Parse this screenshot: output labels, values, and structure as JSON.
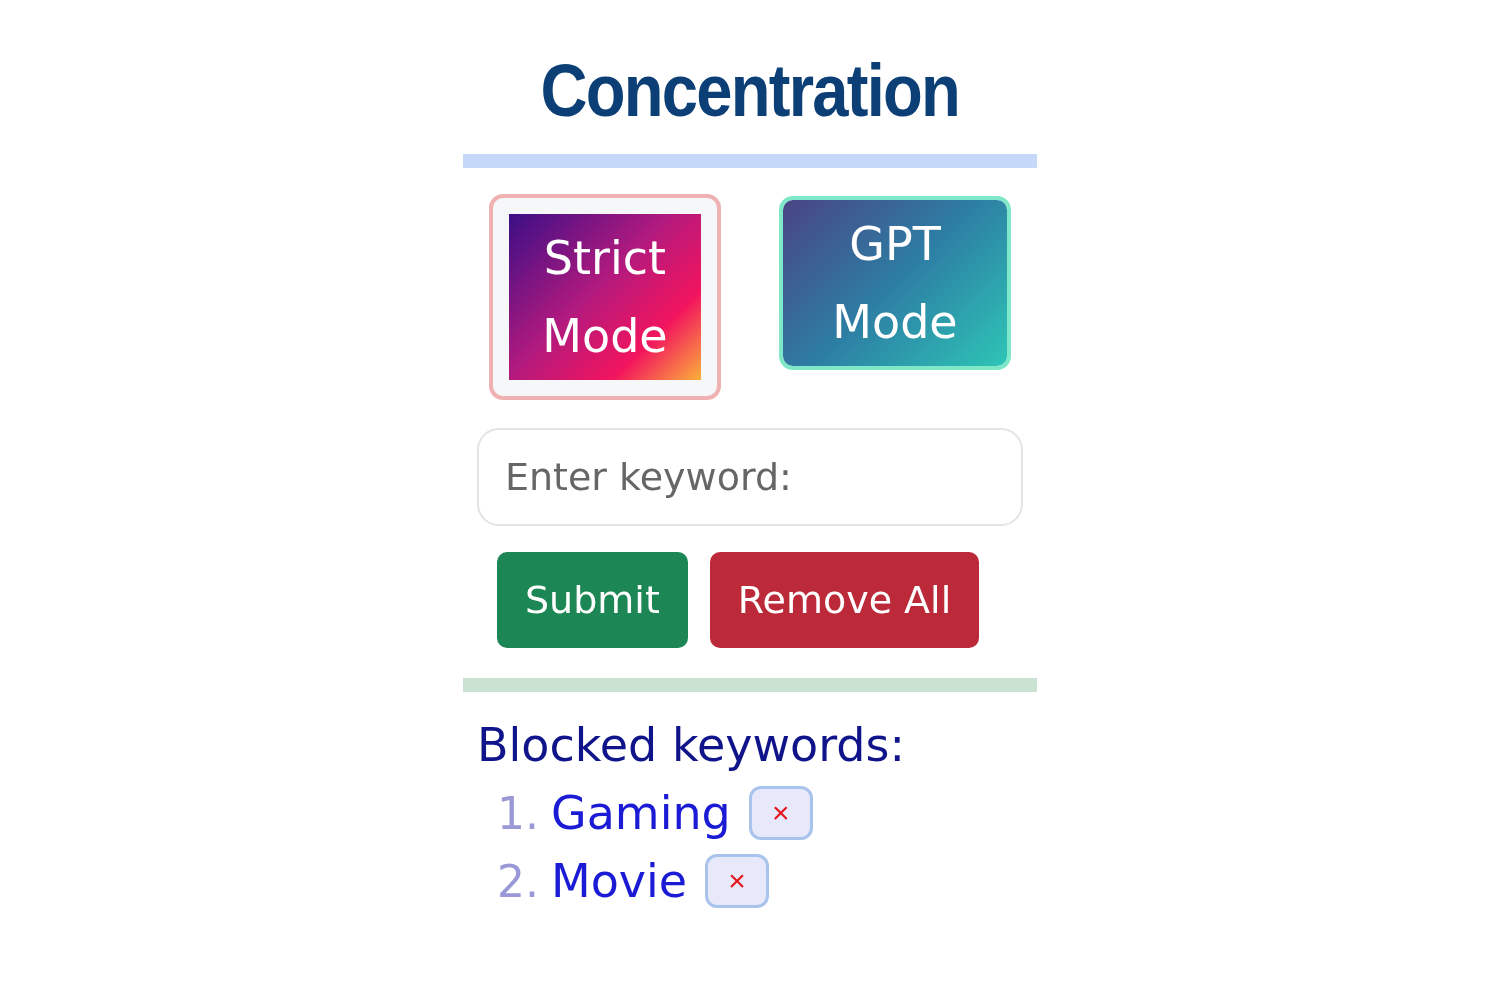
{
  "title": "Concentration",
  "modes": [
    {
      "label_lines": [
        "Strict",
        "Mode"
      ],
      "kind": "strict",
      "selected": true
    },
    {
      "label_lines": [
        "GPT",
        "Mode"
      ],
      "kind": "gpt",
      "selected": false
    }
  ],
  "keyword_field": {
    "placeholder": "Enter keyword:"
  },
  "buttons": [
    {
      "label": "Submit",
      "kind": "submit"
    },
    {
      "label": "Remove All",
      "kind": "remove"
    }
  ],
  "blocked": {
    "heading": "Blocked keywords:",
    "items": [
      {
        "number": "1.",
        "keyword": "Gaming",
        "remove": "×"
      },
      {
        "number": "2.",
        "keyword": "Movie",
        "remove": "×"
      }
    ]
  }
}
